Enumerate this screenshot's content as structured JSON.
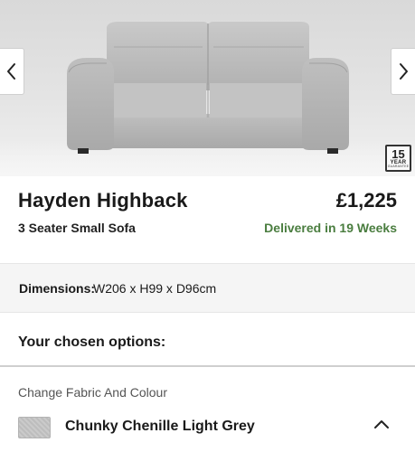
{
  "gallery": {
    "prev_icon": "chevron-left-icon",
    "next_icon": "chevron-right-icon",
    "guarantee_badge": {
      "number": "15",
      "unit": "YEAR",
      "caption": "GUARANTEE"
    }
  },
  "product": {
    "title": "Hayden Highback",
    "subtitle": "3 Seater Small Sofa",
    "price": "£1,225",
    "delivery": "Delivered in 19 Weeks"
  },
  "dimensions": {
    "label": "Dimensions:",
    "value": "W206 x H99 x D96cm"
  },
  "options": {
    "heading": "Your chosen options:",
    "fabric_label": "Change Fabric And Colour",
    "fabric_name": "Chunky Chenille Light Grey",
    "toggle_icon": "chevron-up-icon"
  },
  "colors": {
    "delivery_green": "#4a7d3f",
    "text": "#1a1a1a",
    "band": "#f5f5f5"
  }
}
